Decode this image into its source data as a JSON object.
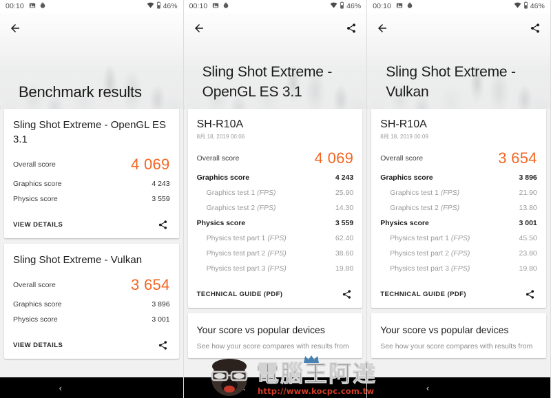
{
  "statusbar": {
    "time": "00:10",
    "icons": [
      "image-icon",
      "record-icon",
      "wifi-icon",
      "battery-icon"
    ],
    "battery": "46%"
  },
  "colors": {
    "accent_orange": "#f26522",
    "card_bg": "#ffffff",
    "page_bg": "#f1f1f1",
    "navbar_bg": "#000000",
    "watermark_url": "#d43c20"
  },
  "watermark": {
    "text": "電腦王阿達",
    "url": "http://www.kocpc.com.tw"
  },
  "navbar": {
    "back_glyph": "‹"
  },
  "panels": [
    {
      "id": "benchmark-results",
      "header": {
        "title": "Benchmark results",
        "back": "back-arrow-icon",
        "share": null
      },
      "cards": [
        {
          "title": "Sling Shot Extreme - OpenGL ES 3.1",
          "subtitle": null,
          "rows": [
            {
              "label": "Overall score",
              "value": "4 069",
              "style": "overall"
            },
            {
              "label": "Graphics score",
              "value": "4 243",
              "style": "normal"
            },
            {
              "label": "Physics score",
              "value": "3 559",
              "style": "normal"
            }
          ],
          "action": {
            "label": "VIEW DETAILS",
            "share": "share-icon"
          }
        },
        {
          "title": "Sling Shot Extreme - Vulkan",
          "subtitle": null,
          "rows": [
            {
              "label": "Overall score",
              "value": "3 654",
              "style": "overall"
            },
            {
              "label": "Graphics score",
              "value": "3 896",
              "style": "normal"
            },
            {
              "label": "Physics score",
              "value": "3 001",
              "style": "normal"
            }
          ],
          "action": {
            "label": "VIEW DETAILS",
            "share": "share-icon"
          }
        }
      ]
    },
    {
      "id": "sling-shot-extreme-opengl",
      "header": {
        "title": "Sling Shot Extreme - OpenGL ES 3.1",
        "back": "back-arrow-icon",
        "share": "share-icon"
      },
      "cards": [
        {
          "title": "SH-R10A",
          "subtitle": "8月 18, 2019 00:06",
          "rows": [
            {
              "label": "Overall score",
              "value": "4 069",
              "style": "overall"
            },
            {
              "label": "Graphics score",
              "value": "4 243",
              "style": "bold"
            },
            {
              "label": "Graphics test 1",
              "suffix": "(FPS)",
              "value": "25.90",
              "style": "sub"
            },
            {
              "label": "Graphics test 2",
              "suffix": "(FPS)",
              "value": "14.30",
              "style": "sub"
            },
            {
              "label": "Physics score",
              "value": "3 559",
              "style": "bold"
            },
            {
              "label": "Physics test part 1",
              "suffix": "(FPS)",
              "value": "62.40",
              "style": "sub"
            },
            {
              "label": "Physics test part 2",
              "suffix": "(FPS)",
              "value": "38.60",
              "style": "sub"
            },
            {
              "label": "Physics test part 3",
              "suffix": "(FPS)",
              "value": "19.80",
              "style": "sub"
            }
          ],
          "action": {
            "label": "TECHNICAL GUIDE (PDF)",
            "share": "share-icon"
          }
        }
      ],
      "compare": {
        "title": "Your score vs popular devices",
        "subtitle": "See how your score compares with results from"
      }
    },
    {
      "id": "sling-shot-extreme-vulkan",
      "header": {
        "title": "Sling Shot Extreme - Vulkan",
        "back": "back-arrow-icon",
        "share": "share-icon"
      },
      "cards": [
        {
          "title": "SH-R10A",
          "subtitle": "8月 18, 2019 00:09",
          "rows": [
            {
              "label": "Overall score",
              "value": "3 654",
              "style": "overall"
            },
            {
              "label": "Graphics score",
              "value": "3 896",
              "style": "bold"
            },
            {
              "label": "Graphics test 1",
              "suffix": "(FPS)",
              "value": "21.90",
              "style": "sub"
            },
            {
              "label": "Graphics test 2",
              "suffix": "(FPS)",
              "value": "13.80",
              "style": "sub"
            },
            {
              "label": "Physics score",
              "value": "3 001",
              "style": "bold"
            },
            {
              "label": "Physics test part 1",
              "suffix": "(FPS)",
              "value": "45.50",
              "style": "sub"
            },
            {
              "label": "Physics test part 2",
              "suffix": "(FPS)",
              "value": "23.80",
              "style": "sub"
            },
            {
              "label": "Physics test part 3",
              "suffix": "(FPS)",
              "value": "19.80",
              "style": "sub"
            }
          ],
          "action": {
            "label": "TECHNICAL GUIDE (PDF)",
            "share": "share-icon"
          }
        }
      ],
      "compare": {
        "title": "Your score vs popular devices",
        "subtitle": "See how your score compares with results from"
      }
    }
  ]
}
